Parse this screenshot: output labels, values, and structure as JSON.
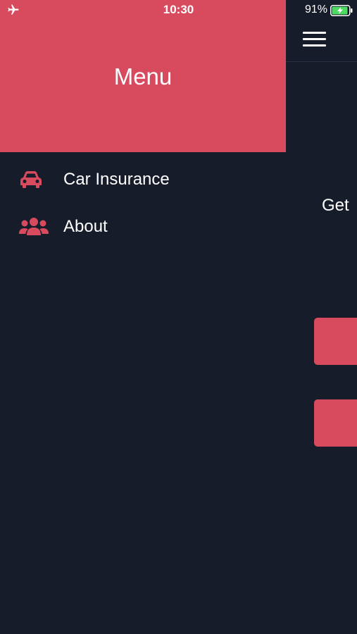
{
  "status_bar": {
    "time": "10:30",
    "battery_percent": "91%",
    "airplane_icon": "airplane-icon",
    "battery_icon": "battery-charging-icon"
  },
  "drawer": {
    "title": "Menu",
    "items": [
      {
        "label": "Car Insurance",
        "icon": "car-icon"
      },
      {
        "label": "About",
        "icon": "users-icon"
      }
    ]
  },
  "main": {
    "menu_icon": "hamburger-icon",
    "partial_text": "Get "
  },
  "colors": {
    "accent": "#d84b5f",
    "background": "#161c29",
    "battery_green": "#4cd964"
  }
}
